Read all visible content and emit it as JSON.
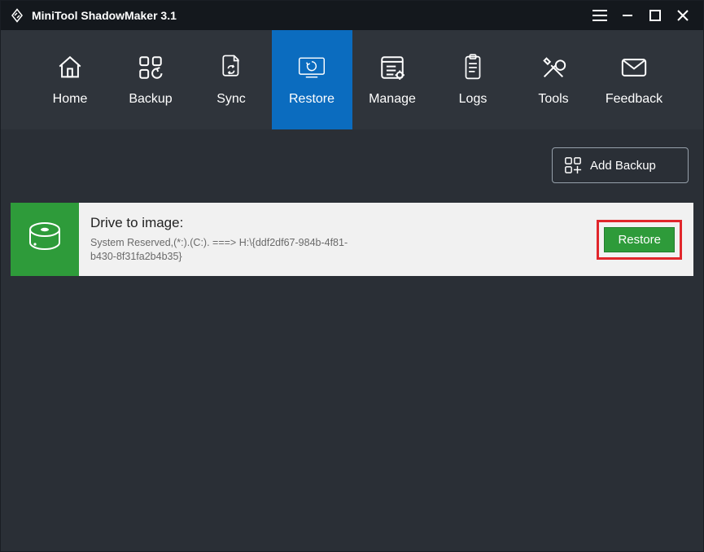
{
  "window": {
    "title": "MiniTool ShadowMaker 3.1"
  },
  "nav": {
    "items": [
      {
        "id": "home",
        "label": "Home",
        "active": false
      },
      {
        "id": "backup",
        "label": "Backup",
        "active": false
      },
      {
        "id": "sync",
        "label": "Sync",
        "active": false
      },
      {
        "id": "restore",
        "label": "Restore",
        "active": true
      },
      {
        "id": "manage",
        "label": "Manage",
        "active": false
      },
      {
        "id": "logs",
        "label": "Logs",
        "active": false
      },
      {
        "id": "tools",
        "label": "Tools",
        "active": false
      },
      {
        "id": "feedback",
        "label": "Feedback",
        "active": false
      }
    ]
  },
  "actions": {
    "add_backup_label": "Add Backup"
  },
  "drive": {
    "heading": "Drive to image:",
    "path": "System Reserved,(*:).(C:). ===> H:\\{ddf2df67-984b-4f81-b430-8f31fa2b4b35}",
    "restore_label": "Restore"
  },
  "colors": {
    "titlebar": "#14181d",
    "nav_bg": "#2f343b",
    "content_bg": "#2a2f36",
    "accent_blue": "#0b6cbf",
    "accent_green": "#2e9b3a",
    "highlight_red": "#e1262b"
  }
}
